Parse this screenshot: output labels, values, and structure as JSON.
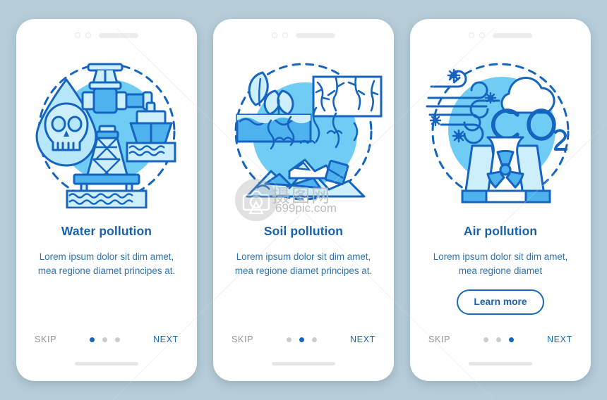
{
  "background_color": "#b6ccd8",
  "theme": {
    "title_color": "#1862ab",
    "body_color": "#2d74b5",
    "accent_color": "#1565c0",
    "skip_color": "#8d9499",
    "next_color": "#1a6bb5",
    "card_color": "#ffffff",
    "illustration_circle": "#6fcdf5",
    "illustration_line": "#1565c0",
    "illustration_fill_light": "#cdeefc",
    "illustration_fill_mid": "#4db2ee"
  },
  "watermark": {
    "site": "699pic.com",
    "cn_text": "摄图网",
    "logo_name": "camera-logo"
  },
  "screens": [
    {
      "id": "water",
      "illustration_name": "water-pollution-illustration",
      "title": "Water pollution",
      "description": "Lorem ipsum dolor sit dim amet, mea regione diamet principes at.",
      "has_cta": false,
      "cta_label": "",
      "skip_label": "SKIP",
      "next_label": "NEXT",
      "dots": [
        true,
        false,
        false
      ]
    },
    {
      "id": "soil",
      "illustration_name": "soil-pollution-illustration",
      "title": "Soil pollution",
      "description": "Lorem ipsum dolor sit dim amet, mea regione diamet principes at.",
      "has_cta": false,
      "cta_label": "",
      "skip_label": "SKIP",
      "next_label": "NEXT",
      "dots": [
        false,
        true,
        false
      ]
    },
    {
      "id": "air",
      "illustration_name": "air-pollution-illustration",
      "title": "Air pollution",
      "description": "Lorem ipsum dolor sit dim amet, mea regione diamet",
      "has_cta": true,
      "cta_label": "Learn more",
      "skip_label": "SKIP",
      "next_label": "NEXT",
      "dots": [
        false,
        false,
        true
      ]
    }
  ]
}
